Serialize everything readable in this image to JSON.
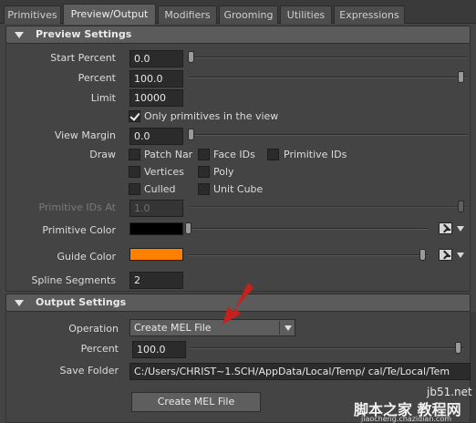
{
  "tabs": [
    {
      "label": "Primitives",
      "active": false
    },
    {
      "label": "Preview/Output",
      "active": true
    },
    {
      "label": "Modifiers",
      "active": false
    },
    {
      "label": "Grooming",
      "active": false
    },
    {
      "label": "Utilities",
      "active": false
    },
    {
      "label": "Expressions",
      "active": false
    }
  ],
  "preview": {
    "title": "Preview Settings",
    "start_percent": {
      "label": "Start Percent",
      "value": "0.0",
      "slider": 0.0
    },
    "percent": {
      "label": "Percent",
      "value": "100.0",
      "slider": 1.0
    },
    "limit": {
      "label": "Limit",
      "value": "10000"
    },
    "only_primitives": {
      "label": "Only primitives in the view",
      "checked": true
    },
    "view_margin": {
      "label": "View Margin",
      "value": "0.0",
      "slider": 0.0
    },
    "draw": {
      "label": "Draw",
      "options": [
        {
          "label": "Patch Nar",
          "checked": false
        },
        {
          "label": "Face IDs",
          "checked": false
        },
        {
          "label": "Primitive IDs",
          "checked": false
        },
        {
          "label": "Vertices",
          "checked": false
        },
        {
          "label": "Poly",
          "checked": false
        },
        {
          "label": "Culled",
          "checked": false
        },
        {
          "label": "Unit Cube",
          "checked": false
        }
      ]
    },
    "primitive_ids_at": {
      "label": "Primitive IDs At",
      "value": "1.0",
      "slider": 1.0,
      "enabled": false
    },
    "primitive_color": {
      "label": "Primitive Color",
      "color": "#000000",
      "slider": 0.0,
      "icon": "color-picker-icon"
    },
    "guide_color": {
      "label": "Guide Color",
      "color": "#ff7f00",
      "slider": 1.0,
      "icon": "color-picker-icon"
    },
    "spline_segments": {
      "label": "Spline Segments",
      "value": "2"
    }
  },
  "output": {
    "title": "Output Settings",
    "operation": {
      "label": "Operation",
      "value": "Create MEL File"
    },
    "percent": {
      "label": "Percent",
      "value": "100.0",
      "slider": 1.0
    },
    "save_folder": {
      "label": "Save Folder",
      "value": "C:/Users/CHRIST~1.SCH/AppData/Local/Temp/      cal/Te/Local/Tem"
    },
    "create_button": "Create MEL File"
  },
  "watermark": {
    "line1": "jb51.net",
    "line2": "脚本之家 教程网",
    "line3": "jiaocheng.chazidian.com"
  },
  "colors": {
    "annotation_arrow": "#c8201a",
    "guide_orange": "#ff7f00"
  }
}
